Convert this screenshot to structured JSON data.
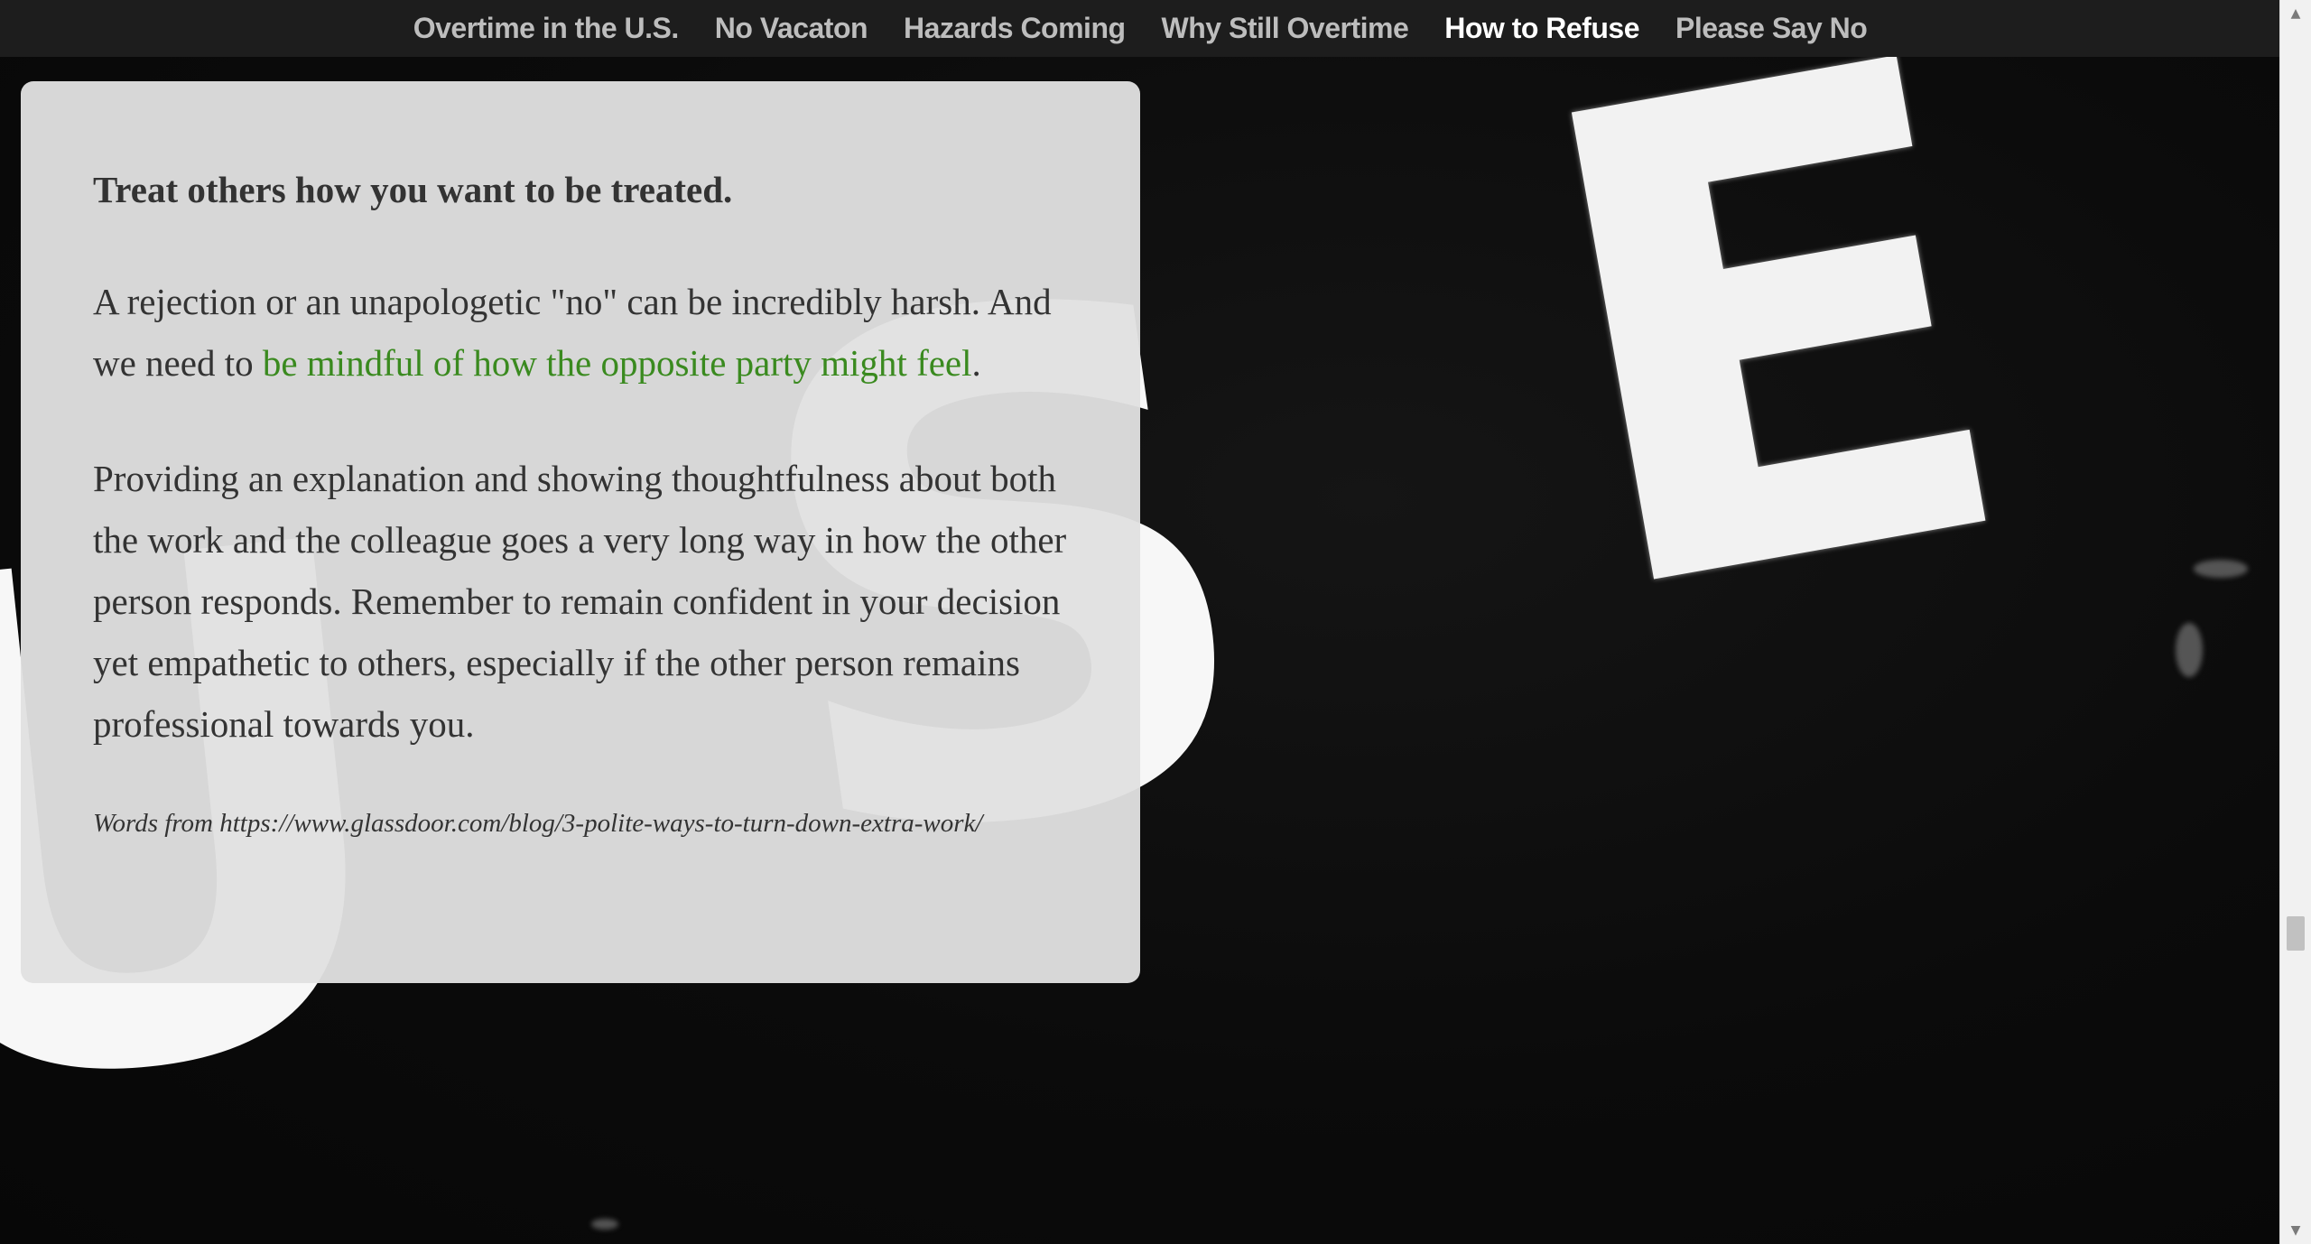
{
  "nav": {
    "items": [
      {
        "label": "Overtime in the U.S.",
        "active": false
      },
      {
        "label": "No Vacaton",
        "active": false
      },
      {
        "label": "Hazards Coming",
        "active": false
      },
      {
        "label": "Why Still Overtime",
        "active": false
      },
      {
        "label": "How to Refuse",
        "active": true
      },
      {
        "label": "Please Say No",
        "active": false
      }
    ]
  },
  "card": {
    "heading": "Treat others how you want to be treated.",
    "paragraph1_before_link": "A rejection or an unapologetic \"no\" can be incredibly harsh. And we need to ",
    "paragraph1_link": "be mindful of how the opposite party might feel",
    "paragraph1_after_link": ".",
    "paragraph2": "Providing an explanation and showing thoughtfulness about both the work and the colleague goes a very long way in how the other person responds. Remember to remain confident in your decision yet empathetic to others, especially if the other person remains professional towards you.",
    "source": "Words from https://www.glassdoor.com/blog/3-polite-ways-to-turn-down-extra-work/"
  },
  "background": {
    "letters": [
      "E",
      "S",
      "U"
    ]
  },
  "colors": {
    "nav_bg": "#1d1d1d",
    "nav_text": "#bdbdbd",
    "nav_active": "#ffffff",
    "card_bg": "#e1e1e1",
    "body_text": "#333333",
    "link": "#3a8a1f"
  },
  "scrollbar": {
    "up_icon": "triangle-up-icon",
    "down_icon": "triangle-down-icon"
  }
}
